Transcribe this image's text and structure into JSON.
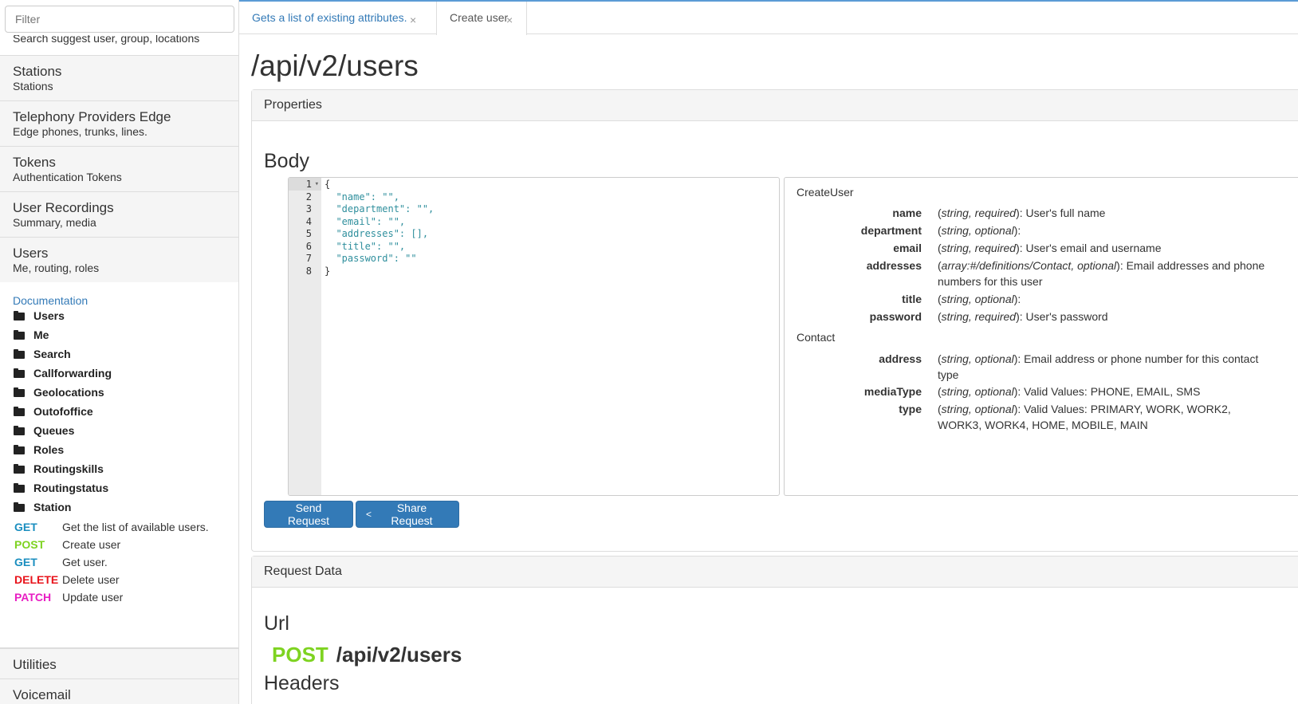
{
  "sidebar": {
    "filter_placeholder": "Filter",
    "cut_hint": "Search suggest user, group, locations",
    "categories": [
      {
        "title": "Stations",
        "subtitle": "Stations"
      },
      {
        "title": "Telephony Providers Edge",
        "subtitle": "Edge phones, trunks, lines."
      },
      {
        "title": "Tokens",
        "subtitle": "Authentication Tokens"
      },
      {
        "title": "User Recordings",
        "subtitle": "Summary, media"
      },
      {
        "title": "Users",
        "subtitle": "Me, routing, roles"
      }
    ],
    "documentation_link": "Documentation",
    "folders": [
      "Users",
      "Me",
      "Search",
      "Callforwarding",
      "Geolocations",
      "Outofoffice",
      "Queues",
      "Roles",
      "Routingskills",
      "Routingstatus",
      "Station"
    ],
    "methods": [
      {
        "verb": "GET",
        "desc": "Get the list of available users."
      },
      {
        "verb": "POST",
        "desc": "Create user"
      },
      {
        "verb": "GET",
        "desc": "Get user."
      },
      {
        "verb": "DELETE",
        "desc": "Delete user"
      },
      {
        "verb": "PATCH",
        "desc": "Update user"
      }
    ],
    "bottom_categories": [
      {
        "title": "Utilities"
      },
      {
        "title": "Voicemail"
      }
    ]
  },
  "tabs": [
    {
      "label": "Gets a list of existing attributes.",
      "close": "×"
    },
    {
      "label": "Create user",
      "close": "×"
    }
  ],
  "main": {
    "title": "/api/v2/users",
    "properties_heading": "Properties",
    "body_heading": "Body",
    "editor": {
      "line_numbers": [
        "1",
        "2",
        "3",
        "4",
        "5",
        "6",
        "7",
        "8"
      ],
      "lines": [
        "{",
        "  \"name\": \"\",",
        "  \"department\": \"\",",
        "  \"email\": \"\",",
        "  \"addresses\": [],",
        "  \"title\": \"\",",
        "  \"password\": \"\"",
        "}"
      ]
    },
    "schema": {
      "create_user_title": "CreateUser",
      "create_user_fields": [
        {
          "name": "name",
          "type": "string, required",
          "desc": ": User's full name"
        },
        {
          "name": "department",
          "type": "string, optional",
          "desc": ":"
        },
        {
          "name": "email",
          "type": "string, required",
          "desc": ": User's email and username"
        },
        {
          "name": "addresses",
          "type": "array:#/definitions/Contact, optional",
          "desc": ": Email addresses and phone numbers for this user"
        },
        {
          "name": "title",
          "type": "string, optional",
          "desc": ":"
        },
        {
          "name": "password",
          "type": "string, required",
          "desc": ": User's password"
        }
      ],
      "contact_title": "Contact",
      "contact_fields": [
        {
          "name": "address",
          "type": "string, optional",
          "desc": ": Email address or phone number for this contact type"
        },
        {
          "name": "mediaType",
          "type": "string, optional",
          "desc": ": Valid Values: PHONE, EMAIL, SMS"
        },
        {
          "name": "type",
          "type": "string, optional",
          "desc": ": Valid Values: PRIMARY, WORK, WORK2, WORK3, WORK4, HOME, MOBILE, MAIN"
        }
      ]
    },
    "send_button": "Send Request",
    "share_button": "Share Request",
    "request_data_heading": "Request Data",
    "url_heading": "Url",
    "url_method": "POST",
    "url_path": "/api/v2/users",
    "headers_heading": "Headers"
  },
  "colors": {
    "accent": "#337ab7",
    "get": "#1a8ebf",
    "post": "#7ed321",
    "delete": "#e8131b",
    "patch": "#e81ec3"
  }
}
